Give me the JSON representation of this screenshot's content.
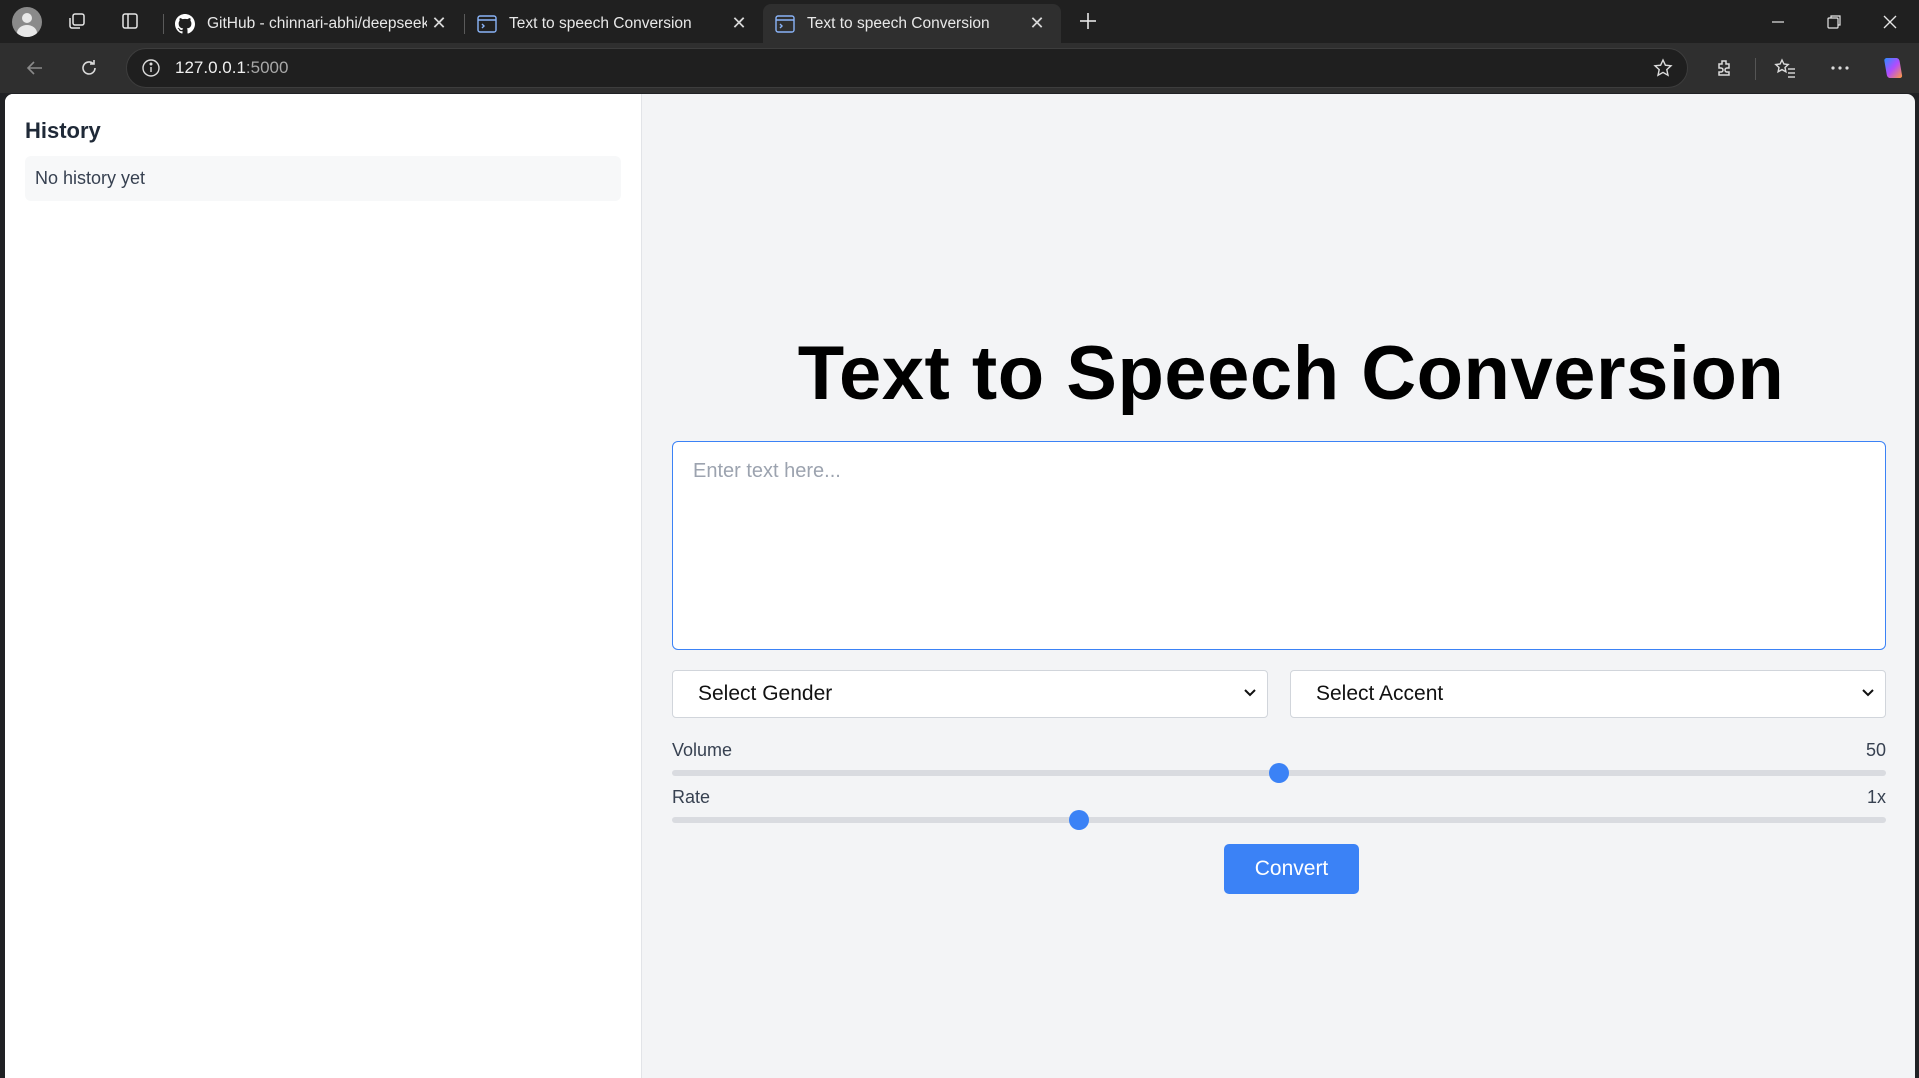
{
  "browser": {
    "tabs": [
      {
        "title": "GitHub - chinnari-abhi/deepseek",
        "favicon": "github-icon"
      },
      {
        "title": "Text to speech Conversion",
        "favicon": "terminal-icon"
      },
      {
        "title": "Text to speech Conversion",
        "favicon": "terminal-icon",
        "active": true
      }
    ],
    "address": {
      "host": "127.0.0.1",
      "port": ":5000"
    }
  },
  "sidebar": {
    "title": "History",
    "empty_message": "No history yet"
  },
  "main": {
    "heading": "Text to Speech Conversion",
    "text_placeholder": "Enter text here...",
    "gender_select": "Select Gender",
    "accent_select": "Select Accent",
    "volume": {
      "label": "Volume",
      "value_text": "50",
      "fraction": 0.5
    },
    "rate": {
      "label": "Rate",
      "value_text": "1x",
      "fraction": 0.335
    },
    "convert_label": "Convert"
  },
  "colors": {
    "accent": "#3b82f6",
    "page_bg": "#f3f4f6"
  }
}
